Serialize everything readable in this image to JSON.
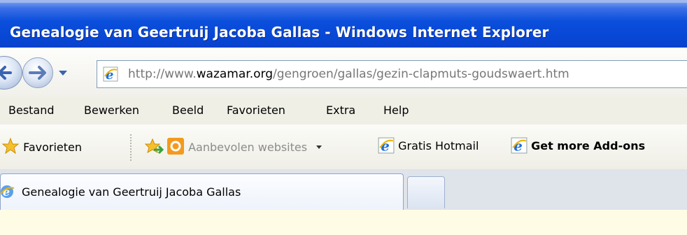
{
  "window": {
    "title": "Genealogie van Geertruij Jacoba Gallas - Windows Internet Explorer"
  },
  "address": {
    "url_prefix": "http://www.",
    "url_domain": "wazamar.org",
    "url_path": "/gengroen/gallas/gezin-clapmuts-goudswaert.htm"
  },
  "menu": {
    "items": [
      "Bestand",
      "Bewerken",
      "Beeld",
      "Favorieten",
      "Extra",
      "Help"
    ]
  },
  "favorites_bar": {
    "favorites_label": "Favorieten",
    "suggested_sites": "Aanbevolen websites",
    "links": [
      "Gratis Hotmail",
      "Get more Add-ons"
    ]
  },
  "tabs": {
    "active_label": "Genealogie van Geertruij Jacoba Gallas"
  }
}
